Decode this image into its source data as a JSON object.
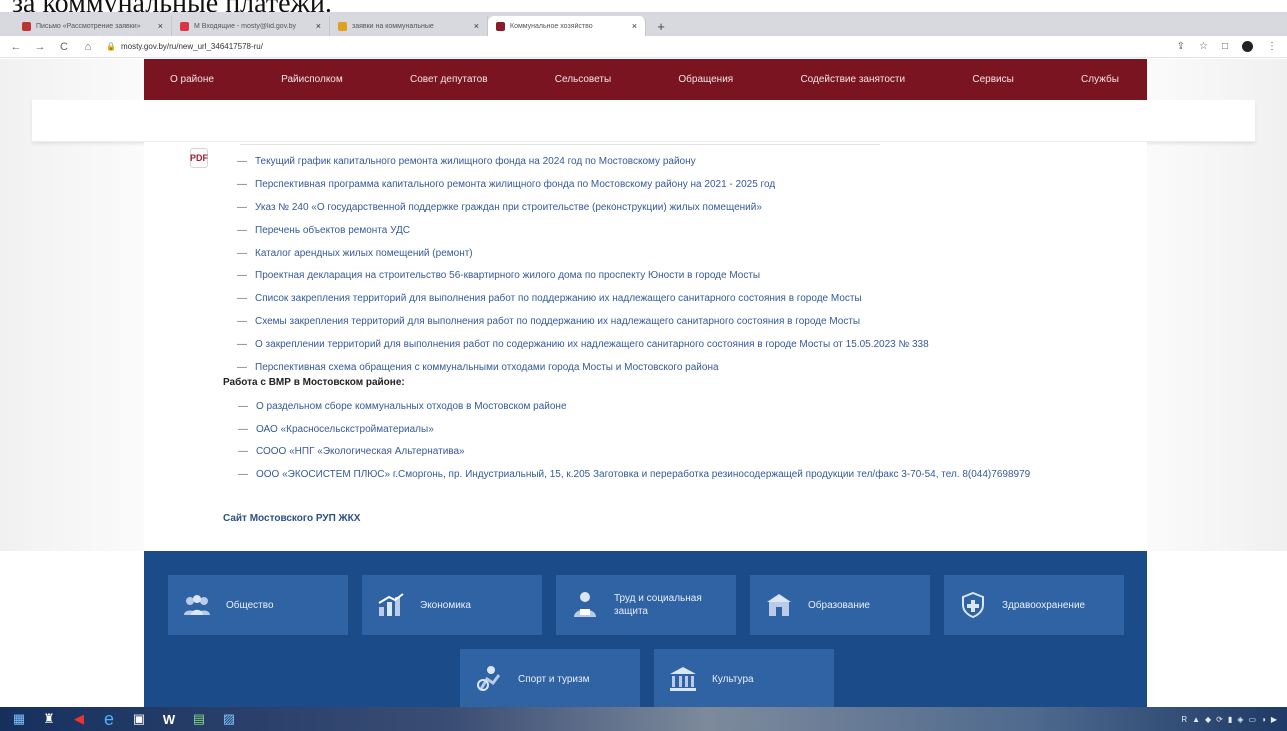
{
  "caption": "за коммунальные платежи.",
  "tabs": [
    {
      "label": "Письмо «Рассмотрение заявки»",
      "close": "×"
    },
    {
      "label": "M Входящие - mosty@lid.gov.by",
      "close": "×"
    },
    {
      "label": "заявки на коммунальные",
      "close": "×"
    },
    {
      "label": "Коммунальное хозяйство",
      "close": "×"
    }
  ],
  "new_tab": "+",
  "browser": {
    "back": "←",
    "forward": "→",
    "reload": "C",
    "home": "⌂",
    "lock": "🔒",
    "url": "mosty.gov.by/ru/new_url_346417578-ru/",
    "share": "⇪",
    "star": "☆",
    "window": "□",
    "menu": "⋮"
  },
  "nav": [
    "О районе",
    "Райисполком",
    "Совет депутатов",
    "Сельсоветы",
    "Обращения",
    "Содействие занятости",
    "Сервисы",
    "Службы"
  ],
  "doc_icon": "PDF",
  "documents": [
    "Текущий график капитального ремонта жилищного фонда на 2024 год по Мостовскому району",
    "Перспективная программа капитального ремонта жилищного фонда по Мостовскому району на 2021 - 2025 год",
    "Указ № 240 «О государственной поддержке граждан при строительстве (реконструкции) жилых помещений»",
    "Перечень объектов ремонта УДС",
    "Каталог арендных жилых помещений (ремонт)",
    "Проектная декларация на строительство 56-квартирного жилого дома по проспекту Юности в городе Мосты",
    "Список закрепления территорий для выполнения работ по поддержанию их надлежащего санитарного состояния в городе Мосты",
    "Схемы закрепления территорий для выполнения работ по поддержанию их надлежащего санитарного состояния в городе Мосты",
    "О закреплении территорий для выполнения работ по содержанию их надлежащего санитарного состояния в городе Мосты от 15.05.2023 № 338",
    "Перспективная схема обращения с коммунальными отходами города Мосты и Мостовского района"
  ],
  "dash": "—",
  "section_title": "Работа с ВМР в Мостовском районе:",
  "vmr": [
    "О раздельном сборе коммунальных отходов в Мостовском районе",
    "ОАО «Красносельскстройматериалы»",
    "СООО «НПГ «Экологическая Альтернатива»",
    "ООО «ЭКОСИСТЕМ ПЛЮС» г.Сморгонь, пр. Индустриальный, 15, к.205 Заготовка и переработка резиносодержащей продукции тел/факс 3-70-54, тел. 8(044)7698979"
  ],
  "site_link": "Сайт Мостовского РУП ЖКХ",
  "tiles": [
    {
      "label": "Общество",
      "icon": "people-icon"
    },
    {
      "label": "Экономика",
      "icon": "chart-icon"
    },
    {
      "label": "Труд и социальная защита",
      "icon": "hands-icon"
    },
    {
      "label": "Образование",
      "icon": "school-icon"
    },
    {
      "label": "Здравоохранение",
      "icon": "health-icon"
    },
    {
      "label": "Спорт и туризм",
      "icon": "sport-icon"
    },
    {
      "label": "Культура",
      "icon": "museum-icon"
    }
  ],
  "taskbar": {
    "start": "▦",
    "apps": [
      "♜",
      "◀",
      "e",
      "▣",
      "W",
      "▤",
      "▨"
    ],
    "tray": [
      "R",
      "▲",
      "◆",
      "⟳",
      "▮",
      "◈",
      "▭",
      "◑",
      "▶"
    ]
  },
  "colors": {
    "nav_bg": "#7a1420",
    "footer_bg": "#1b4b88",
    "tile_bg": "#2f63a4",
    "link": "#355a9a"
  }
}
